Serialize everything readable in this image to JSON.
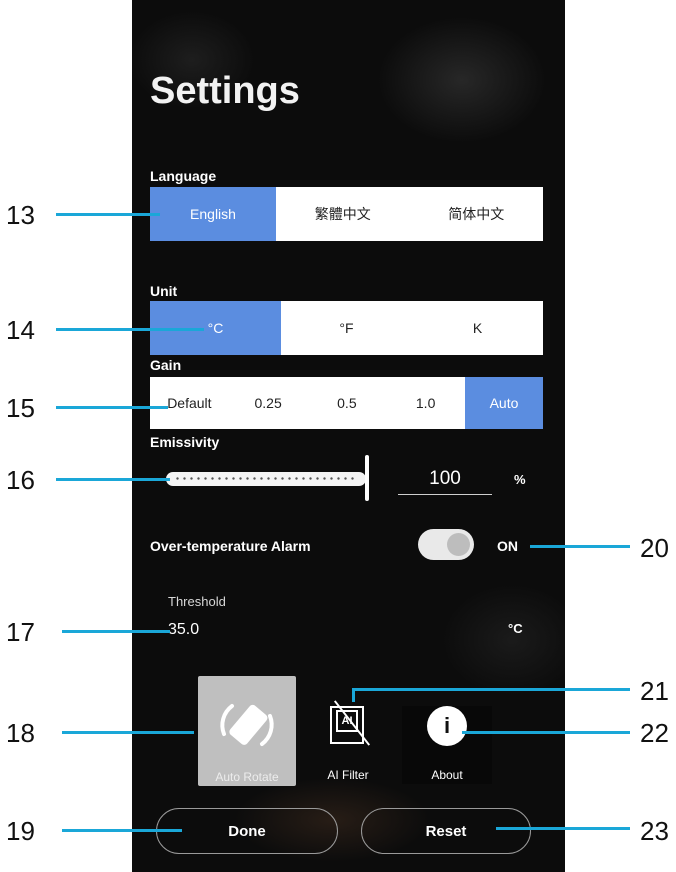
{
  "header": {
    "title": "Settings"
  },
  "language": {
    "label": "Language",
    "options": [
      "English",
      "繁體中文",
      "简体中文"
    ],
    "selected": "English"
  },
  "unit": {
    "label": "Unit",
    "options": [
      "°C",
      "°F",
      "K"
    ],
    "selected": "°C"
  },
  "gain": {
    "label": "Gain",
    "options": [
      "Default",
      "0.25",
      "0.5",
      "1.0",
      "Auto"
    ],
    "selected": "Auto"
  },
  "emissivity": {
    "label": "Emissivity",
    "value": "100",
    "unit": "%",
    "level": 1.0
  },
  "alarm": {
    "label": "Over-temperature Alarm",
    "state": "ON",
    "enabled": true,
    "threshold_label": "Threshold",
    "threshold_value": "35.0",
    "threshold_unit": "°C"
  },
  "actions": {
    "auto_rotate": "Auto Rotate",
    "ai_filter": "AI Filter",
    "ai_badge": "AI",
    "about": "About",
    "about_glyph": "i",
    "done": "Done",
    "reset": "Reset"
  },
  "callouts": {
    "n13": "13",
    "n14": "14",
    "n15": "15",
    "n16": "16",
    "n17": "17",
    "n18": "18",
    "n19": "19",
    "n20": "20",
    "n21": "21",
    "n22": "22",
    "n23": "23"
  },
  "colors": {
    "accent": "#5b8de0",
    "callout": "#1aa7d8",
    "panel": "#0c0c0c"
  }
}
